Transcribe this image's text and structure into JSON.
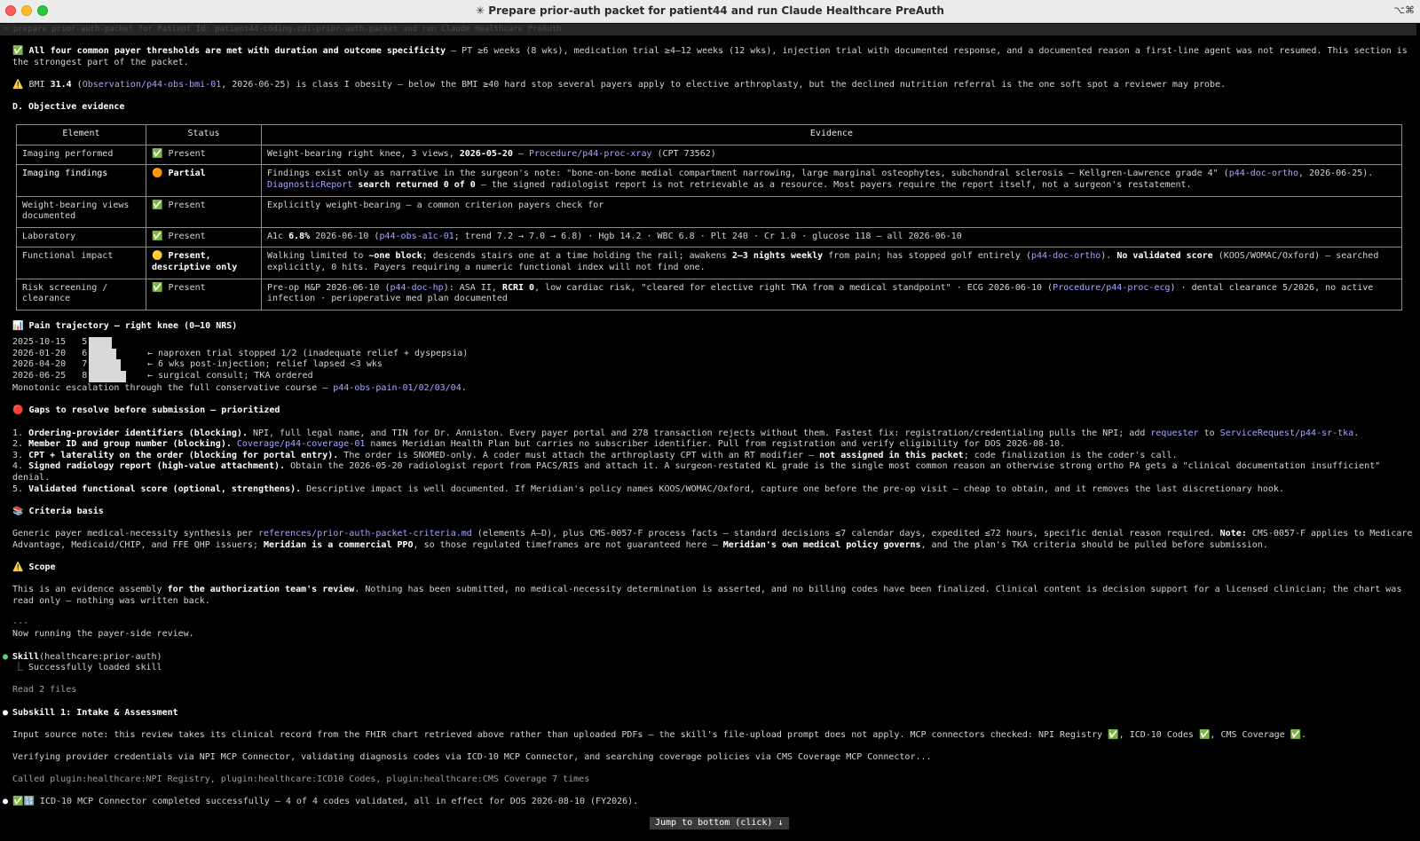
{
  "window": {
    "title": "✳ Prepare prior-auth packet for patient44 and run Claude Healthcare PreAuth",
    "shortcut_hint": "⌥⌘"
  },
  "prompt": "> prepare prior-auth-packet for Patient Id: patient44-coding-cdi-prior-auth-packet and run Claude Healthcare PreAuth",
  "thresholds": {
    "icon": "✅",
    "bold": "All four common payer thresholds are met with duration and outcome specificity",
    "text": " – PT ≥6 weeks (8 wks), medication trial ≥4–12 weeks (12 wks), injection trial with documented response, and a documented reason a first-line agent was not resumed. This section is the strongest part of the packet."
  },
  "bmi": {
    "icon": "⚠️",
    "pre": " BMI ",
    "value": "31.4",
    "paren_open": " (",
    "link": "Observation/p44-obs-bmi-01",
    "post": ", 2026-06-25) is class I obesity – below the BMI ≥40 hard stop several payers apply to elective arthroplasty, but the declined nutrition referral is the one soft spot a reviewer may probe."
  },
  "objective_heading": "D. Objective evidence",
  "table": {
    "headers": [
      "Element",
      "Status",
      "Evidence"
    ],
    "rows": [
      {
        "element": "Imaging performed",
        "status_icon": "✅",
        "status": "Present",
        "evidence_html": "Weight-bearing right knee, 3 views, <b class='w'>2026-05-20</b> – <span class='lk'>Procedure/p44-proc-xray</span> (CPT 73562)"
      },
      {
        "element": "Imaging findings",
        "element_bold": true,
        "status_icon": "🟠",
        "status": "Partial",
        "status_bold": true,
        "evidence_html": "Findings exist only as narrative in the surgeon's note: \"bone-on-bone medial compartment narrowing, large marginal osteophytes, subchondral sclerosis – Kellgren-Lawrence grade 4\" (<span class='lk'>p44-doc-ortho</span>, 2026-06-25). <span class='lk'>DiagnosticReport</span> <b class='w'>search returned 0 of 0</b> – the signed radiologist report is not retrievable as a resource. Most payers require the report itself, not a surgeon's restatement."
      },
      {
        "element": "Weight-bearing views documented",
        "status_icon": "✅",
        "status": "Present",
        "evidence_html": "Explicitly weight-bearing – a common criterion payers check for"
      },
      {
        "element": "Laboratory",
        "status_icon": "✅",
        "status": "Present",
        "evidence_html": "A1c <b class='w'>6.8%</b> 2026-06-10 (<span class='lk'>p44-obs-a1c-01</span>; trend 7.2 → 7.0 → 6.8) · Hgb 14.2 · WBC 6.8 · Plt 240 · Cr 1.0 · glucose 118 – all 2026-06-10"
      },
      {
        "element": "Functional impact",
        "status_icon": "🟡",
        "status": "Present, descriptive only",
        "status_bold": true,
        "evidence_html": "Walking limited to <b class='w'>~one block</b>; descends stairs one at a time holding the rail; awakens <b class='w'>2–3 nights weekly</b> from pain; has stopped golf entirely (<span class='lk'>p44-doc-ortho</span>). <b class='w'>No validated score</b> (KOOS/WOMAC/Oxford) – searched explicitly, 0 hits. Payers requiring a numeric functional index will not find one."
      },
      {
        "element": "Risk screening / clearance",
        "status_icon": "✅",
        "status": "Present",
        "evidence_html": "Pre-op H&amp;P 2026-06-10 (<span class='lk'>p44-doc-hp</span>): ASA II, <b class='w'>RCRI 0</b>, low cardiac risk, \"cleared for elective right TKA from a medical standpoint\" · ECG 2026-06-10 (<span class='lk'>Procedure/p44-proc-ecg</span>) · dental clearance 5/2026, no active infection · perioperative med plan documented"
      }
    ]
  },
  "pain": {
    "icon": "📊",
    "heading": " Pain trajectory – right knee (0–10 NRS)",
    "scale_max": 10,
    "points": [
      {
        "date": "2025-10-15",
        "score": 5,
        "note": ""
      },
      {
        "date": "2026-01-20",
        "score": 6,
        "note": "← naproxen trial stopped 1/2 (inadequate relief + dyspepsia)"
      },
      {
        "date": "2026-04-20",
        "score": 7,
        "note": "← 6 wks post-injection; relief lapsed <3 wks"
      },
      {
        "date": "2026-06-25",
        "score": 8,
        "note": "← surgical consult; TKA ordered"
      }
    ],
    "footer_pre": "Monotonic escalation through the full conservative course – ",
    "footer_link": "p44-obs-pain-01/02/03/04",
    "footer_post": "."
  },
  "gaps": {
    "icon": "🔴",
    "heading": " Gaps to resolve before submission – prioritized",
    "items": [
      {
        "num": "1.",
        "bold": "Ordering-provider identifiers (blocking).",
        "html": " NPI, full legal name, and TIN for Dr. Anniston. Every payer portal and 278 transaction rejects without them. Fastest fix: registration/credentialing pulls the NPI; add <span class='lk'>requester</span> to <span class='lk'>ServiceRequest/p44-sr-tka</span>."
      },
      {
        "num": "2.",
        "bold": "Member ID and group number (blocking).",
        "html": " <span class='lk'>Coverage/p44-coverage-01</span> names Meridian Health Plan but carries no subscriber identifier. Pull from registration and verify eligibility for DOS 2026-08-10."
      },
      {
        "num": "3.",
        "bold": "CPT + laterality on the order (blocking for portal entry).",
        "html": " The order is SNOMED-only. A coder must attach the arthroplasty CPT with an RT modifier – <b class='w'>not assigned in this packet</b>; code finalization is the coder's call."
      },
      {
        "num": "4.",
        "bold": "Signed radiology report (high-value attachment).",
        "html": " Obtain the 2026-05-20 radiologist report from PACS/RIS and attach it. A surgeon-restated KL grade is the single most common reason an otherwise strong ortho PA gets a \"clinical documentation insufficient\" denial."
      },
      {
        "num": "5.",
        "bold": "Validated functional score (optional, strengthens).",
        "html": " Descriptive impact is well documented. If Meridian's policy names KOOS/WOMAC/Oxford, capture one before the pre-op visit – cheap to obtain, and it removes the last discretionary hook."
      }
    ]
  },
  "criteria": {
    "icon": "📚",
    "heading": " Criteria basis",
    "html": "Generic payer medical-necessity synthesis per <span class='lk'>references/prior-auth-packet-criteria.md</span> (elements A–D), plus CMS-0057-F process facts – standard decisions ≤7 calendar days, expedited ≤72 hours, specific denial reason required. <b class='w'>Note:</b> CMS-0057-F applies to Medicare Advantage, Medicaid/CHIP, and FFE QHP issuers; <b class='w'>Meridian is a commercial PPO</b>, so those regulated timeframes are not guaranteed here – <b class='w'>Meridian's own medical policy governs</b>, and the plan's TKA criteria should be pulled before submission."
  },
  "scope": {
    "icon": "⚠️",
    "heading": " Scope",
    "html": "This is an evidence assembly <b class='w'>for the authorization team's review</b>. Nothing has been submitted, no medical-necessity determination is asserted, and no billing codes have been finalized. Clinical content is decision support for a licensed clinician; the chart was read only – nothing was written back."
  },
  "separator": "---",
  "running": "Now running the payer-side review.",
  "skill": {
    "name": "Skill",
    "arg": "(healthcare:prior-auth)",
    "status": "⎿  Successfully loaded skill"
  },
  "read_files": "Read 2 files",
  "subskill": "Subskill 1: Intake & Assessment",
  "input_note": "Input source note: this review takes its clinical record from the FHIR chart retrieved above rather than uploaded PDFs – the skill's file-upload prompt does not apply. MCP connectors checked: NPI Registry ✅, ICD-10 Codes ✅, CMS Coverage ✅.",
  "verifying": "Verifying provider credentials via NPI MCP Connector, validating diagnosis codes via ICD-10 MCP Connector, and searching coverage policies via CMS Coverage MCP Connector...",
  "called": "Called plugin:healthcare:NPI Registry, plugin:healthcare:ICD10 Codes, plugin:healthcare:CMS Coverage 7 times",
  "icd_result": "✅🔢 ICD-10 MCP Connector completed successfully – 4 of 4 codes validated, all in effect for DOS 2026-08-10 (FY2026).",
  "jump": "Jump to bottom (click) ↓",
  "colors": {
    "link": "#a5a8ff",
    "bullet_green": "#5fd16b",
    "background": "#000000"
  }
}
